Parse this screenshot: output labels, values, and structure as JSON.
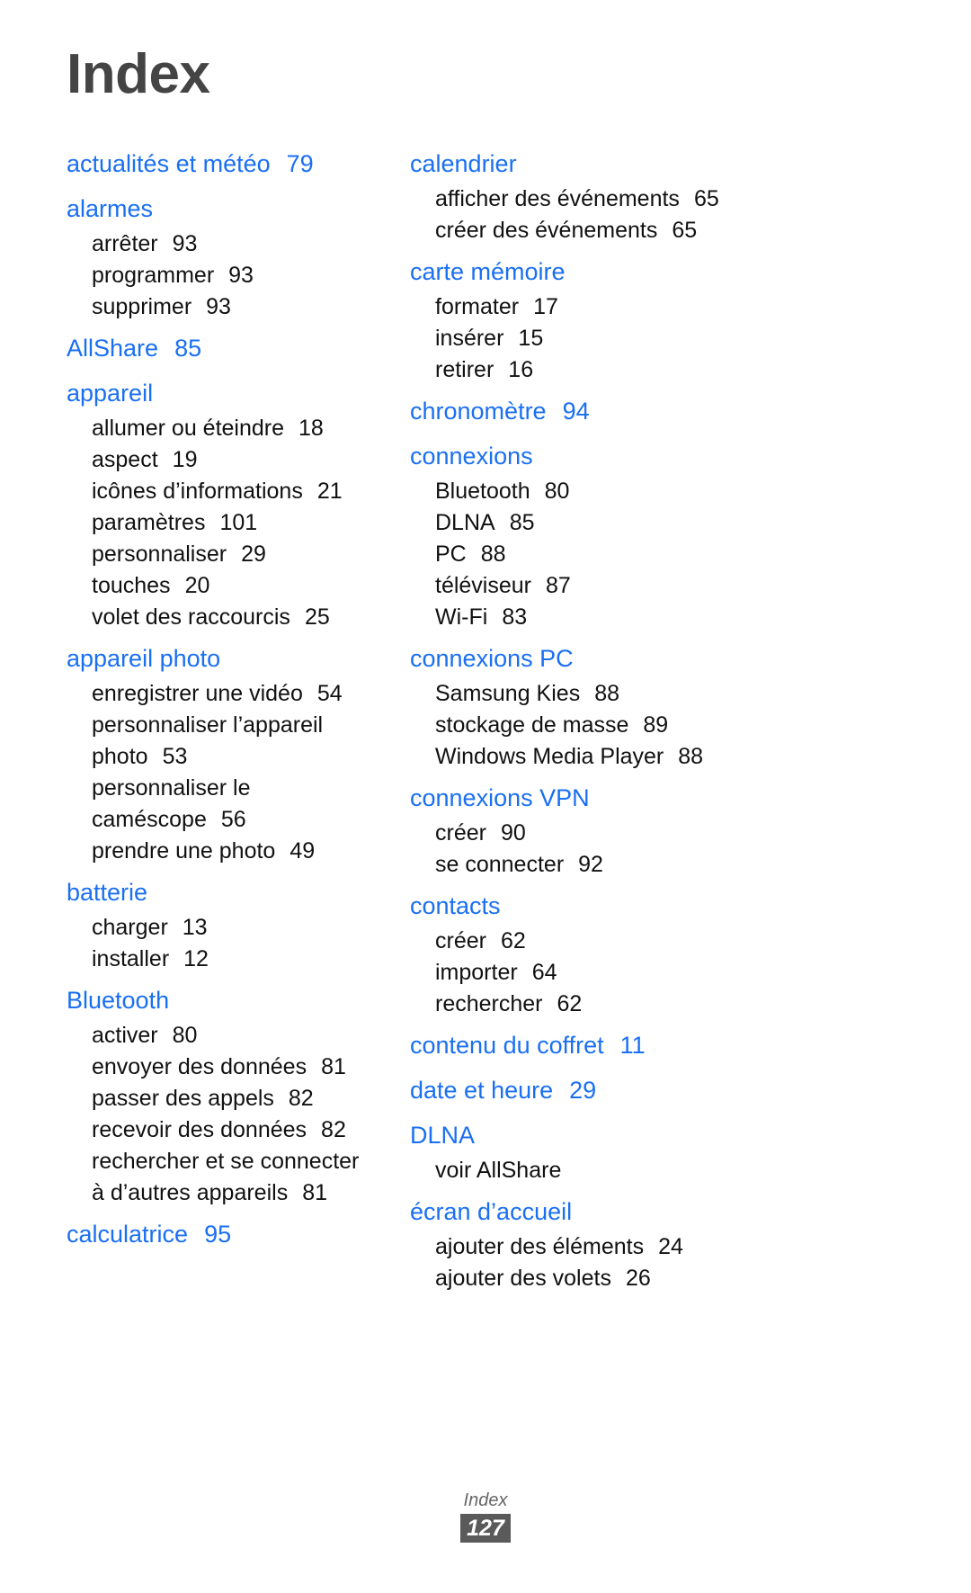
{
  "document": {
    "title": "Index",
    "footer_label": "Index",
    "footer_page_number": "127",
    "accent_color": "#1a6ff2",
    "title_color": "#444444",
    "footer_badge_color": "#5a5a5a"
  },
  "columns": [
    {
      "name": "left-column",
      "groups": [
        {
          "heading": "actualités et météo",
          "heading_page": "79",
          "entries": []
        },
        {
          "heading": "alarmes",
          "heading_page": "",
          "entries": [
            {
              "label": "arrêter",
              "page": "93"
            },
            {
              "label": "programmer",
              "page": "93"
            },
            {
              "label": "supprimer",
              "page": "93"
            }
          ]
        },
        {
          "heading": "AllShare",
          "heading_page": "85",
          "entries": []
        },
        {
          "heading": "appareil",
          "heading_page": "",
          "entries": [
            {
              "label": "allumer ou éteindre",
              "page": "18"
            },
            {
              "label": "aspect",
              "page": "19"
            },
            {
              "label": "icônes d’informations",
              "page": "21"
            },
            {
              "label": "paramètres",
              "page": "101"
            },
            {
              "label": "personnaliser",
              "page": "29"
            },
            {
              "label": "touches",
              "page": "20"
            },
            {
              "label": "volet des raccourcis",
              "page": "25"
            }
          ]
        },
        {
          "heading": "appareil photo",
          "heading_page": "",
          "entries": [
            {
              "label": "enregistrer une vidéo",
              "page": "54"
            },
            {
              "label": "personnaliser l’appareil photo",
              "page": "53",
              "wrap": true
            },
            {
              "label": "personnaliser le caméscope",
              "page": "56",
              "wrap": true
            },
            {
              "label": "prendre une photo",
              "page": "49"
            }
          ]
        },
        {
          "heading": "batterie",
          "heading_page": "",
          "entries": [
            {
              "label": "charger",
              "page": "13"
            },
            {
              "label": "installer",
              "page": "12"
            }
          ]
        },
        {
          "heading": "Bluetooth",
          "heading_page": "",
          "entries": [
            {
              "label": "activer",
              "page": "80"
            },
            {
              "label": "envoyer des données",
              "page": "81"
            },
            {
              "label": "passer des appels",
              "page": "82"
            },
            {
              "label": "recevoir des données",
              "page": "82"
            },
            {
              "label": "rechercher et se connecter à d’autres appareils",
              "page": "81",
              "wrap": true
            }
          ]
        },
        {
          "heading": "calculatrice",
          "heading_page": "95",
          "entries": []
        }
      ]
    },
    {
      "name": "right-column",
      "groups": [
        {
          "heading": "calendrier",
          "heading_page": "",
          "entries": [
            {
              "label": "afficher des événements",
              "page": "65"
            },
            {
              "label": "créer des événements",
              "page": "65"
            }
          ]
        },
        {
          "heading": "carte mémoire",
          "heading_page": "",
          "entries": [
            {
              "label": "formater",
              "page": "17"
            },
            {
              "label": "insérer",
              "page": "15"
            },
            {
              "label": "retirer",
              "page": "16"
            }
          ]
        },
        {
          "heading": "chronomètre",
          "heading_page": "94",
          "entries": []
        },
        {
          "heading": "connexions",
          "heading_page": "",
          "entries": [
            {
              "label": "Bluetooth",
              "page": "80"
            },
            {
              "label": "DLNA",
              "page": "85"
            },
            {
              "label": "PC",
              "page": "88"
            },
            {
              "label": "téléviseur",
              "page": "87"
            },
            {
              "label": "Wi-Fi",
              "page": "83"
            }
          ]
        },
        {
          "heading": "connexions PC",
          "heading_page": "",
          "entries": [
            {
              "label": "Samsung Kies",
              "page": "88"
            },
            {
              "label": "stockage de masse",
              "page": "89"
            },
            {
              "label": "Windows Media Player",
              "page": "88"
            }
          ]
        },
        {
          "heading": "connexions VPN",
          "heading_page": "",
          "entries": [
            {
              "label": "créer",
              "page": "90"
            },
            {
              "label": "se connecter",
              "page": "92"
            }
          ]
        },
        {
          "heading": "contacts",
          "heading_page": "",
          "entries": [
            {
              "label": "créer",
              "page": "62"
            },
            {
              "label": "importer",
              "page": "64"
            },
            {
              "label": "rechercher",
              "page": "62"
            }
          ]
        },
        {
          "heading": "contenu du coffret",
          "heading_page": "11",
          "entries": []
        },
        {
          "heading": "date et heure",
          "heading_page": "29",
          "entries": []
        },
        {
          "heading": "DLNA",
          "heading_page": "",
          "entries": [
            {
              "label": "voir AllShare",
              "page": ""
            }
          ]
        },
        {
          "heading": "écran d’accueil",
          "heading_page": "",
          "entries": [
            {
              "label": "ajouter des éléments",
              "page": "24"
            },
            {
              "label": "ajouter des volets",
              "page": "26"
            }
          ]
        }
      ]
    }
  ]
}
